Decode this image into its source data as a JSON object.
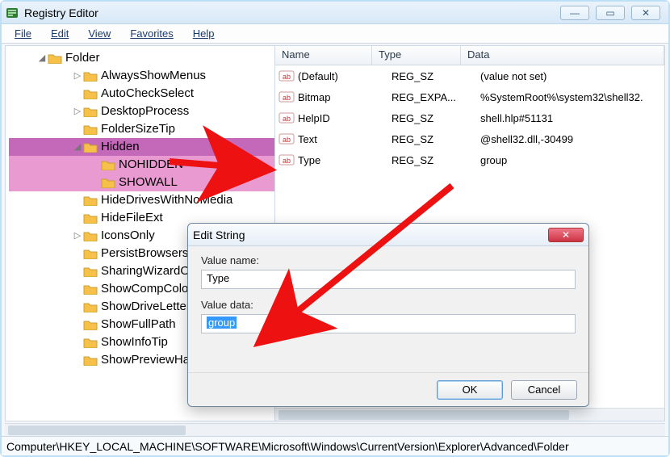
{
  "app": {
    "title": "Registry Editor"
  },
  "menu": {
    "file": "File",
    "edit": "Edit",
    "view": "View",
    "favorites": "Favorites",
    "help": "Help"
  },
  "window_controls": {
    "min": "—",
    "max": "▭",
    "close": "✕"
  },
  "tree": {
    "root": "Folder",
    "items": [
      {
        "label": "AlwaysShowMenus",
        "expander": "▷",
        "depth": 2
      },
      {
        "label": "AutoCheckSelect",
        "expander": "",
        "depth": 2
      },
      {
        "label": "DesktopProcess",
        "expander": "▷",
        "depth": 2
      },
      {
        "label": "FolderSizeTip",
        "expander": "",
        "depth": 2
      },
      {
        "label": "Hidden",
        "expander": "◢",
        "depth": 2,
        "hl": "sel"
      },
      {
        "label": "NOHIDDEN",
        "expander": "",
        "depth": 3,
        "hl": "mag"
      },
      {
        "label": "SHOWALL",
        "expander": "",
        "depth": 3,
        "hl": "mag"
      },
      {
        "label": "HideDrivesWithNoMedia",
        "expander": "",
        "depth": 2
      },
      {
        "label": "HideFileExt",
        "expander": "",
        "depth": 2
      },
      {
        "label": "IconsOnly",
        "expander": "▷",
        "depth": 2
      },
      {
        "label": "PersistBrowsers",
        "expander": "",
        "depth": 2
      },
      {
        "label": "SharingWizardOn",
        "expander": "",
        "depth": 2
      },
      {
        "label": "ShowCompColor",
        "expander": "",
        "depth": 2
      },
      {
        "label": "ShowDriveLettersFirst",
        "expander": "",
        "depth": 2
      },
      {
        "label": "ShowFullPath",
        "expander": "",
        "depth": 2
      },
      {
        "label": "ShowInfoTip",
        "expander": "",
        "depth": 2
      },
      {
        "label": "ShowPreviewHandlers",
        "expander": "",
        "depth": 2
      }
    ]
  },
  "list": {
    "headers": {
      "name": "Name",
      "type": "Type",
      "data": "Data"
    },
    "rows": [
      {
        "name": "(Default)",
        "type": "REG_SZ",
        "data": "(value not set)"
      },
      {
        "name": "Bitmap",
        "type": "REG_EXPA...",
        "data": "%SystemRoot%\\system32\\shell32."
      },
      {
        "name": "HelpID",
        "type": "REG_SZ",
        "data": "shell.hlp#51131"
      },
      {
        "name": "Text",
        "type": "REG_SZ",
        "data": "@shell32.dll,-30499"
      },
      {
        "name": "Type",
        "type": "REG_SZ",
        "data": "group"
      }
    ]
  },
  "dialog": {
    "title": "Edit String",
    "value_name_label": "Value name:",
    "value_name": "Type",
    "value_data_label": "Value data:",
    "value_data": "group",
    "ok": "OK",
    "cancel": "Cancel",
    "close": "✕"
  },
  "statusbar": "Computer\\HKEY_LOCAL_MACHINE\\SOFTWARE\\Microsoft\\Windows\\CurrentVersion\\Explorer\\Advanced\\Folder"
}
